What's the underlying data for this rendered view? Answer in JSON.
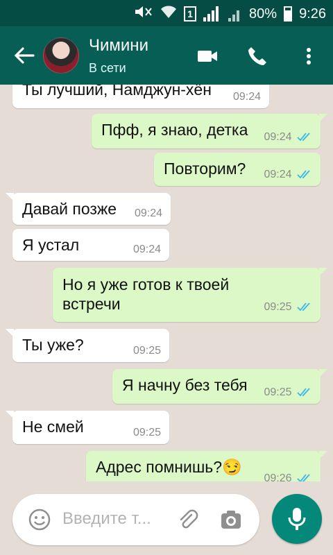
{
  "status_bar": {
    "sim_label": "1",
    "battery": "80%",
    "time": "9:26"
  },
  "header": {
    "contact_name": "Чимини",
    "contact_status": "В сети"
  },
  "messages": [
    {
      "dir": "in",
      "text": "Ты лучший, Намджун-хён",
      "time": "09:24"
    },
    {
      "dir": "out",
      "text": "Пфф, я знаю, детка",
      "time": "09:24"
    },
    {
      "dir": "out",
      "text": "Повторим?",
      "time": "09:24"
    },
    {
      "dir": "in",
      "text": "Давай позже",
      "time": "09:24"
    },
    {
      "dir": "in",
      "text": "Я устал",
      "time": "09:24"
    },
    {
      "dir": "out",
      "text": "Но я уже готов к твоей встречи",
      "time": "09:25"
    },
    {
      "dir": "in",
      "text": "Ты уже?",
      "time": "09:25"
    },
    {
      "dir": "out",
      "text": "Я начну без тебя",
      "time": "09:25"
    },
    {
      "dir": "in",
      "text": "Не смей",
      "time": "09:25"
    },
    {
      "dir": "out",
      "text": "Адрес помнишь?😏",
      "time": "09:26"
    }
  ],
  "composer": {
    "placeholder": "Введите т..."
  },
  "colors": {
    "header_bg": "#075e54",
    "statusbar_bg": "#054d44",
    "incoming_bubble": "#ffffff",
    "outgoing_bubble": "#dcf8c6",
    "tick_blue": "#34b7f1",
    "mic_button": "#03887a"
  },
  "icons": {
    "back": "arrow-left-icon",
    "video": "video-call-icon",
    "phone": "phone-icon",
    "menu": "more-vert-icon",
    "emoji": "emoji-icon",
    "attach": "paperclip-icon",
    "camera": "camera-icon",
    "mic": "microphone-icon"
  }
}
